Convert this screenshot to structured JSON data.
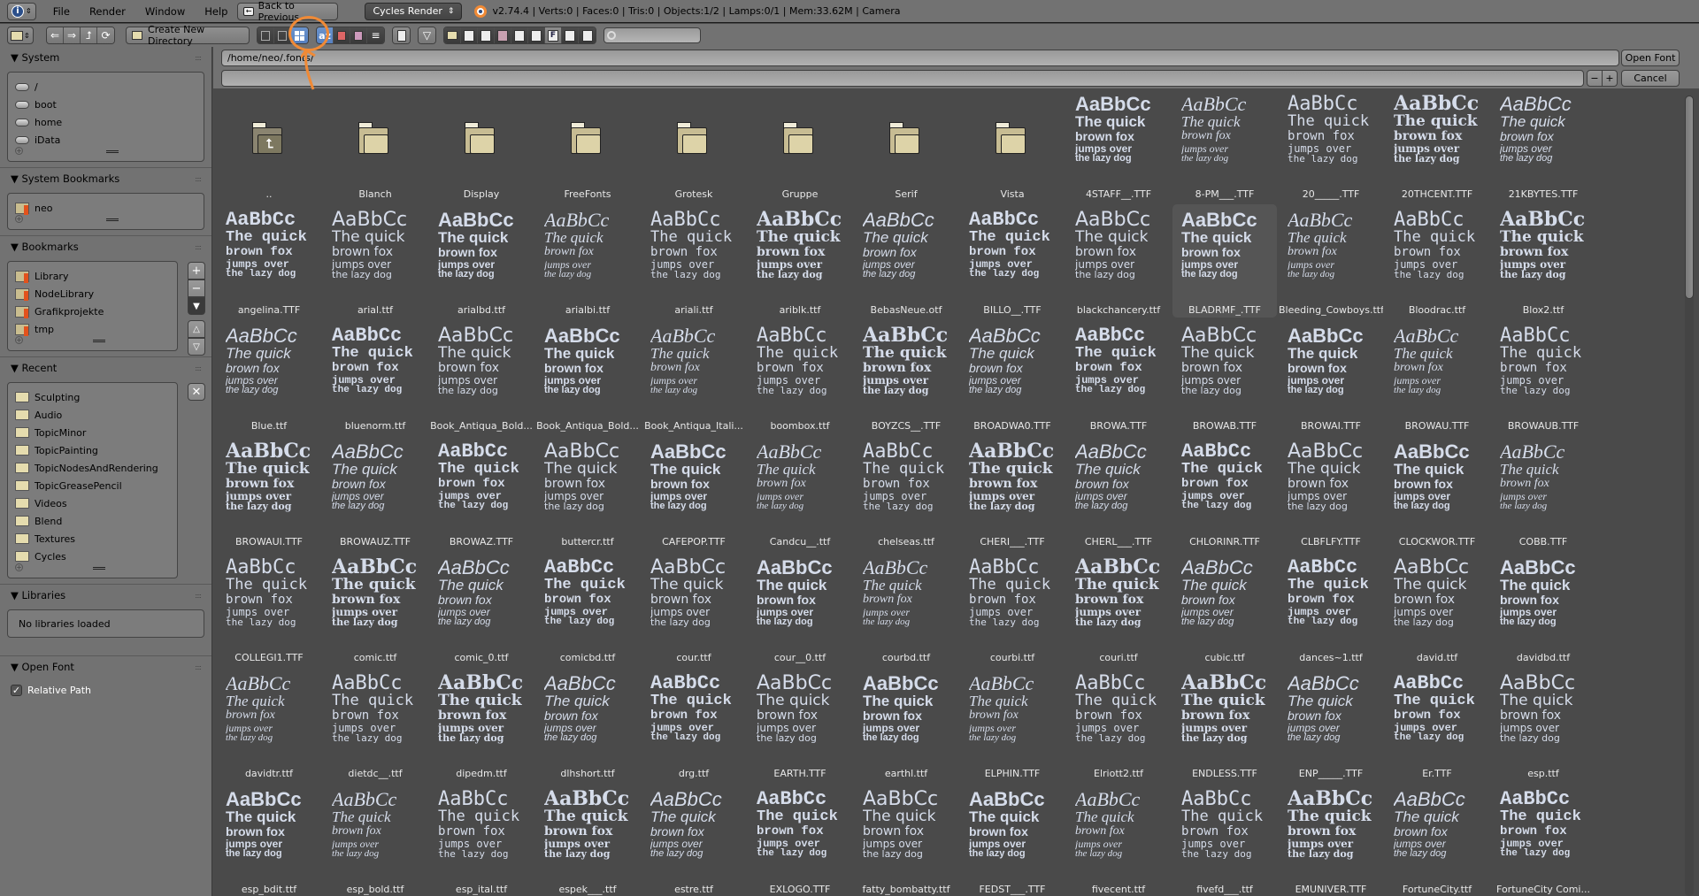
{
  "header": {
    "info_icon": "info-icon",
    "menus": [
      "File",
      "Render",
      "Window",
      "Help"
    ],
    "back_button": "Back to Previous",
    "render_engine": "Cycles Render",
    "stats": "v2.74.4 | Verts:0 | Faces:0 | Tris:0 | Objects:1/2 | Lamps:0/1 | Mem:33.62M | Camera"
  },
  "toolbar": {
    "create_dir": "Create New Directory",
    "search_placeholder": ""
  },
  "path": {
    "directory": "/home/neo/.fonts/",
    "filename": "",
    "open_button": "Open Font",
    "cancel_button": "Cancel"
  },
  "sidebar": {
    "system": {
      "title": "System",
      "items": [
        "/",
        "boot",
        "home",
        "iData"
      ]
    },
    "system_bookmarks": {
      "title": "System Bookmarks",
      "items": [
        "neo"
      ]
    },
    "bookmarks": {
      "title": "Bookmarks",
      "items": [
        "Library",
        "NodeLibrary",
        "Grafikprojekte",
        "tmp"
      ]
    },
    "recent": {
      "title": "Recent",
      "items": [
        "Sculpting",
        "Audio",
        "TopicMinor",
        "TopicPainting",
        "TopicNodesAndRendering",
        "TopicGreasePencil",
        "Videos",
        "Blend",
        "Textures",
        "Cycles"
      ]
    },
    "libraries": {
      "title": "Libraries",
      "empty": "No libraries loaded"
    },
    "open_font": {
      "title": "Open Font",
      "relative_path": "Relative Path",
      "relative_checked": true
    }
  },
  "preview_text": [
    "AaBbCc",
    "The quick",
    "brown fox",
    "jumps over",
    "the lazy dog"
  ],
  "files": [
    {
      "name": "..",
      "type": "parent"
    },
    {
      "name": "Blanch",
      "type": "folder"
    },
    {
      "name": "Display",
      "type": "folder"
    },
    {
      "name": "FreeFonts",
      "type": "folder"
    },
    {
      "name": "Grotesk",
      "type": "folder"
    },
    {
      "name": "Gruppe",
      "type": "folder"
    },
    {
      "name": "Serif",
      "type": "folder"
    },
    {
      "name": "Vista",
      "type": "folder"
    },
    {
      "name": "4STAFF__.TTF",
      "type": "font"
    },
    {
      "name": "8-PM___.TTF",
      "type": "font"
    },
    {
      "name": "20_____.TTF",
      "type": "font"
    },
    {
      "name": "20THCENT.TTF",
      "type": "font"
    },
    {
      "name": "21KBYTES.TTF",
      "type": "font"
    },
    {
      "name": "angelina.TTF",
      "type": "font"
    },
    {
      "name": "arial.ttf",
      "type": "font"
    },
    {
      "name": "arialbd.ttf",
      "type": "font"
    },
    {
      "name": "arialbi.ttf",
      "type": "font"
    },
    {
      "name": "ariali.ttf",
      "type": "font"
    },
    {
      "name": "ariblk.ttf",
      "type": "font"
    },
    {
      "name": "BebasNeue.otf",
      "type": "font"
    },
    {
      "name": "BILLO__.TTF",
      "type": "font"
    },
    {
      "name": "blackchancery.ttf",
      "type": "font"
    },
    {
      "name": "BLADRMF_.TTF",
      "type": "font",
      "highlighted": true
    },
    {
      "name": "Bleeding_Cowboys.ttf",
      "type": "font"
    },
    {
      "name": "Bloodrac.ttf",
      "type": "font"
    },
    {
      "name": "Blox2.ttf",
      "type": "font"
    },
    {
      "name": "Blue.ttf",
      "type": "font"
    },
    {
      "name": "bluenorm.ttf",
      "type": "font"
    },
    {
      "name": "Book_Antiqua_Bold...",
      "type": "font"
    },
    {
      "name": "Book_Antiqua_Bold...",
      "type": "font"
    },
    {
      "name": "Book_Antiqua_Itali...",
      "type": "font"
    },
    {
      "name": "boombox.ttf",
      "type": "font"
    },
    {
      "name": "BOYZCS__.TTF",
      "type": "font"
    },
    {
      "name": "BROADWA0.TTF",
      "type": "font"
    },
    {
      "name": "BROWA.TTF",
      "type": "font"
    },
    {
      "name": "BROWAB.TTF",
      "type": "font"
    },
    {
      "name": "BROWAI.TTF",
      "type": "font"
    },
    {
      "name": "BROWAU.TTF",
      "type": "font"
    },
    {
      "name": "BROWAUB.TTF",
      "type": "font"
    },
    {
      "name": "BROWAUI.TTF",
      "type": "font"
    },
    {
      "name": "BROWAUZ.TTF",
      "type": "font"
    },
    {
      "name": "BROWAZ.TTF",
      "type": "font"
    },
    {
      "name": "buttercr.ttf",
      "type": "font"
    },
    {
      "name": "CAFEPOP.TTF",
      "type": "font"
    },
    {
      "name": "Candcu__.ttf",
      "type": "font"
    },
    {
      "name": "chelseas.ttf",
      "type": "font"
    },
    {
      "name": "CHERI___.TTF",
      "type": "font"
    },
    {
      "name": "CHERL___.TTF",
      "type": "font"
    },
    {
      "name": "CHLORINR.TTF",
      "type": "font"
    },
    {
      "name": "CLBFLFY.TTF",
      "type": "font"
    },
    {
      "name": "CLOCKWOR.TTF",
      "type": "font"
    },
    {
      "name": "COBB.TTF",
      "type": "font"
    },
    {
      "name": "COLLEGI1.TTF",
      "type": "font"
    },
    {
      "name": "comic.ttf",
      "type": "font"
    },
    {
      "name": "comic_0.ttf",
      "type": "font"
    },
    {
      "name": "comicbd.ttf",
      "type": "font"
    },
    {
      "name": "cour.ttf",
      "type": "font"
    },
    {
      "name": "cour__0.ttf",
      "type": "font"
    },
    {
      "name": "courbd.ttf",
      "type": "font"
    },
    {
      "name": "courbi.ttf",
      "type": "font"
    },
    {
      "name": "couri.ttf",
      "type": "font"
    },
    {
      "name": "cubic.ttf",
      "type": "font"
    },
    {
      "name": "dances~1.ttf",
      "type": "font"
    },
    {
      "name": "david.ttf",
      "type": "font"
    },
    {
      "name": "davidbd.ttf",
      "type": "font"
    },
    {
      "name": "davidtr.ttf",
      "type": "font"
    },
    {
      "name": "dietdc__.ttf",
      "type": "font"
    },
    {
      "name": "dipedm.ttf",
      "type": "font"
    },
    {
      "name": "dlhshort.ttf",
      "type": "font"
    },
    {
      "name": "drg.ttf",
      "type": "font"
    },
    {
      "name": "EARTH.TTF",
      "type": "font"
    },
    {
      "name": "earthl.ttf",
      "type": "font"
    },
    {
      "name": "ELPHIN.TTF",
      "type": "font"
    },
    {
      "name": "Elriott2.ttf",
      "type": "font"
    },
    {
      "name": "ENDLESS.TTF",
      "type": "font"
    },
    {
      "name": "ENP_____.TTF",
      "type": "font"
    },
    {
      "name": "Er.TTF",
      "type": "font"
    },
    {
      "name": "esp.ttf",
      "type": "font"
    },
    {
      "name": "esp_bdit.ttf",
      "type": "font"
    },
    {
      "name": "esp_bold.ttf",
      "type": "font"
    },
    {
      "name": "esp_ital.ttf",
      "type": "font"
    },
    {
      "name": "espek___.ttf",
      "type": "font"
    },
    {
      "name": "estre.ttf",
      "type": "font"
    },
    {
      "name": "EXLOGO.TTF",
      "type": "font"
    },
    {
      "name": "fatty_bombatty.ttf",
      "type": "font"
    },
    {
      "name": "FEDST___.TTF",
      "type": "font"
    },
    {
      "name": "fivecent.ttf",
      "type": "font"
    },
    {
      "name": "fivefd___.ttf",
      "type": "font"
    },
    {
      "name": "EMUNIVER.TTF",
      "type": "font"
    },
    {
      "name": "FortuneCity.ttf",
      "type": "font"
    },
    {
      "name": "FortuneCity Comi...",
      "type": "font"
    }
  ],
  "colors": {
    "accent": "#5680c0",
    "annotation": "#f08a36",
    "preview_text": "#d5dcea",
    "bookmark": "#e2521c"
  }
}
